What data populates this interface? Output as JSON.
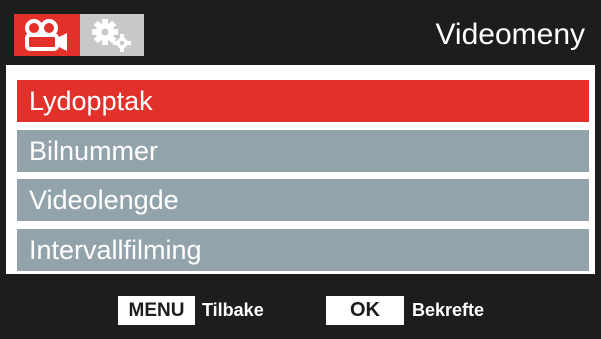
{
  "header": {
    "title": "Videomeny",
    "tabs": [
      {
        "icon": "video-camera-icon",
        "active": true,
        "color": "#e1312a"
      },
      {
        "icon": "gears-icon",
        "active": false,
        "color": "#c8c8c8"
      }
    ]
  },
  "menu": {
    "items": [
      {
        "label": "Lydopptak",
        "selected": true
      },
      {
        "label": "Bilnummer",
        "selected": false
      },
      {
        "label": "Videolengde",
        "selected": false
      },
      {
        "label": "Intervallfilming",
        "selected": false
      }
    ]
  },
  "footer": {
    "menu_key": "MENU",
    "menu_action": "Tilbake",
    "ok_key": "OK",
    "ok_action": "Bekrefte"
  },
  "colors": {
    "accent": "#e1312a",
    "item_bg": "#93a3ab",
    "background": "#1d1d1b"
  }
}
